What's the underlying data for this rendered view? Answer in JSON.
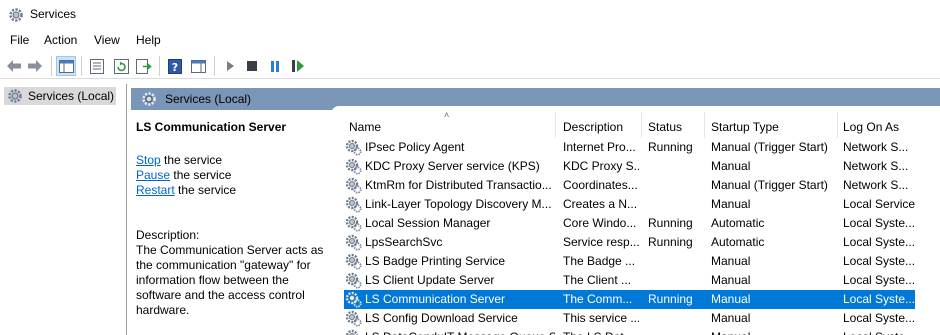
{
  "window": {
    "title": "Services"
  },
  "menu": [
    "File",
    "Action",
    "View",
    "Help"
  ],
  "toolbar": {
    "buttons": [
      "back-icon",
      "forward-icon",
      "show-hide-console-tree-icon",
      "properties-icon",
      "refresh-icon",
      "export-list-icon",
      "help-icon",
      "show-hide-action-pane-icon",
      "start-service-icon",
      "stop-service-icon",
      "pause-service-icon",
      "restart-service-icon"
    ]
  },
  "tree": {
    "root_label": "Services (Local)"
  },
  "main": {
    "header_label": "Services (Local)",
    "detail": {
      "service_name": "LS Communication Server",
      "actions": [
        {
          "link": "Stop",
          "rest": " the service"
        },
        {
          "link": "Pause",
          "rest": " the service"
        },
        {
          "link": "Restart",
          "rest": " the service"
        }
      ],
      "description_label": "Description:",
      "description_lines": [
        "The Communication Server acts as",
        "the communication \"gateway\" for",
        "information flow between the",
        "software and the access control",
        "hardware."
      ]
    },
    "columns": [
      "Name",
      "Description",
      "Status",
      "Startup Type",
      "Log On As"
    ],
    "rows": [
      {
        "name": "IPsec Policy Agent",
        "description": "Internet Pro...",
        "status": "Running",
        "startup": "Manual (Trigger Start)",
        "logon": "Network S..."
      },
      {
        "name": "KDC Proxy Server service (KPS)",
        "description": "KDC Proxy S...",
        "status": "",
        "startup": "Manual",
        "logon": "Network S..."
      },
      {
        "name": "KtmRm for Distributed Transactio...",
        "description": "Coordinates...",
        "status": "",
        "startup": "Manual (Trigger Start)",
        "logon": "Network S..."
      },
      {
        "name": "Link-Layer Topology Discovery M...",
        "description": "Creates a N...",
        "status": "",
        "startup": "Manual",
        "logon": "Local Service"
      },
      {
        "name": "Local Session Manager",
        "description": "Core Windo...",
        "status": "Running",
        "startup": "Automatic",
        "logon": "Local Syste..."
      },
      {
        "name": "LpsSearchSvc",
        "description": "Service resp...",
        "status": "Running",
        "startup": "Automatic",
        "logon": "Local Syste..."
      },
      {
        "name": "LS Badge Printing Service",
        "description": "The Badge ...",
        "status": "",
        "startup": "Manual",
        "logon": "Local Syste..."
      },
      {
        "name": "LS Client Update Server",
        "description": "The Client ...",
        "status": "",
        "startup": "Manual",
        "logon": "Local Syste..."
      },
      {
        "name": "LS Communication Server",
        "description": "The Comm...",
        "status": "Running",
        "startup": "Manual",
        "logon": "Local Syste...",
        "selected": true
      },
      {
        "name": "LS Config Download Service",
        "description": "This service ...",
        "status": "",
        "startup": "Manual",
        "logon": "Local Syste..."
      },
      {
        "name": "LS DataConduIT Message Queue Se...",
        "description": "The LS Dat...",
        "status": "",
        "startup": "Manual",
        "logon": "Local Syste..."
      }
    ]
  },
  "colors": {
    "selection": "#0078d7",
    "header_band": "#7996b8",
    "link": "#0066cc"
  }
}
